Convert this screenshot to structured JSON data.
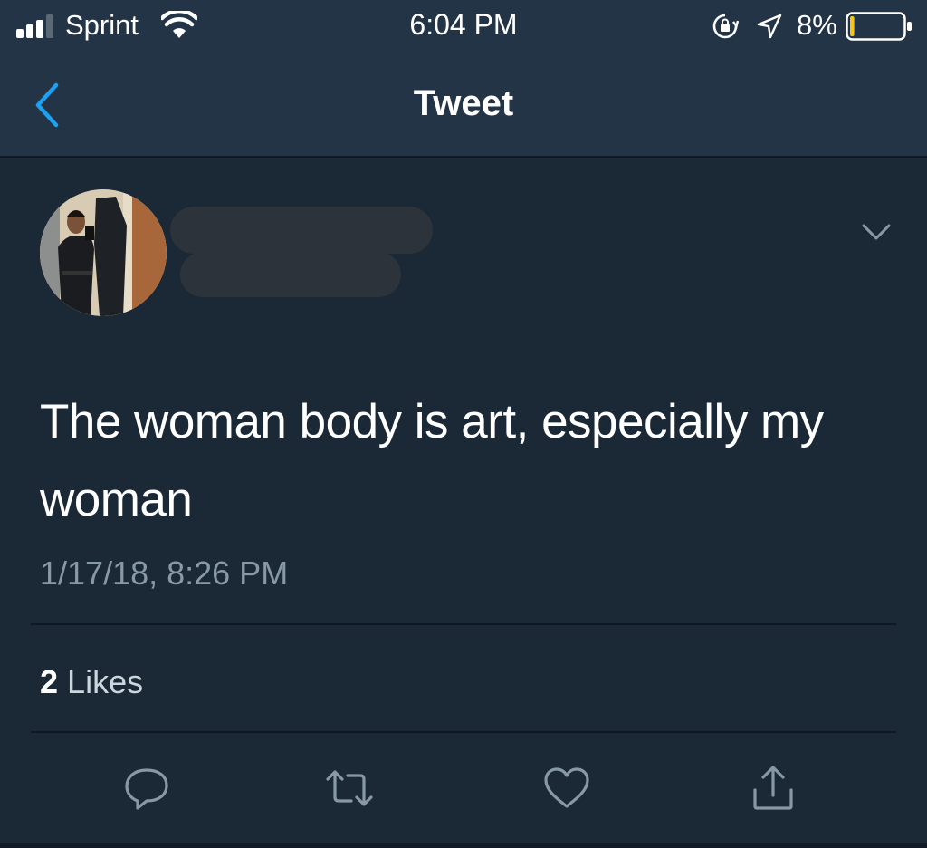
{
  "status_bar": {
    "carrier": "Sprint",
    "time": "6:04 PM",
    "battery_percent": "8%",
    "battery_level": 0.08,
    "signal_icon": "signal-bars-icon",
    "wifi_icon": "wifi-icon",
    "rotation_lock_icon": "rotation-lock-icon",
    "location_icon": "location-arrow-icon",
    "battery_icon": "battery-icon"
  },
  "nav": {
    "title": "Tweet",
    "back_icon": "chevron-left-icon"
  },
  "tweet": {
    "text": "The woman body is art, especially my woman",
    "timestamp": "1/17/18, 8:26 PM",
    "likes_count": "2",
    "likes_label": "Likes",
    "caret_icon": "chevron-down-icon"
  },
  "actions": {
    "reply_icon": "reply-icon",
    "retweet_icon": "retweet-icon",
    "like_icon": "heart-icon",
    "share_icon": "share-icon"
  },
  "colors": {
    "background": "#1b2836",
    "bar_background": "#243447",
    "accent": "#1da1f2",
    "secondary_text": "#8899a6",
    "icon": "#8899a6",
    "battery_low": "#f5c518"
  }
}
